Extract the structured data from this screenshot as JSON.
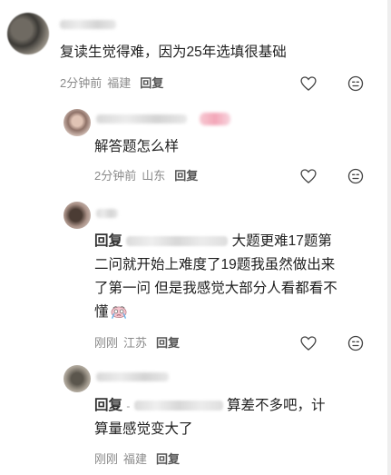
{
  "comments": [
    {
      "text": "复读生觉得难，因为25年选填很基础",
      "time": "2分钟前",
      "location": "福建",
      "reply_label": "回复"
    }
  ],
  "replies": [
    {
      "text": "解答题怎么样",
      "time": "2分钟前",
      "location": "山东",
      "reply_label": "回复"
    },
    {
      "prefix": "回复",
      "line1": "大题更难17题第",
      "line2": "二问就开始上难度了19题我虽然做出来",
      "line3": "了第一问 但是我感觉大部分人看都看不",
      "line4": "懂",
      "time": "刚刚",
      "location": "江苏",
      "reply_label": "回复"
    },
    {
      "prefix": "回复",
      "dash": "-",
      "line1": "算差不多吧，计",
      "line2": "算量感觉变大了",
      "time": "刚刚",
      "location": "福建",
      "reply_label": "回复"
    }
  ],
  "icons": {
    "like": "heart-outline-icon",
    "dislike": "unhappy-face-icon",
    "emoji": "crying-face-emoji"
  },
  "colors": {
    "meta": "#8a8a8a",
    "text": "#1f1f1f"
  }
}
